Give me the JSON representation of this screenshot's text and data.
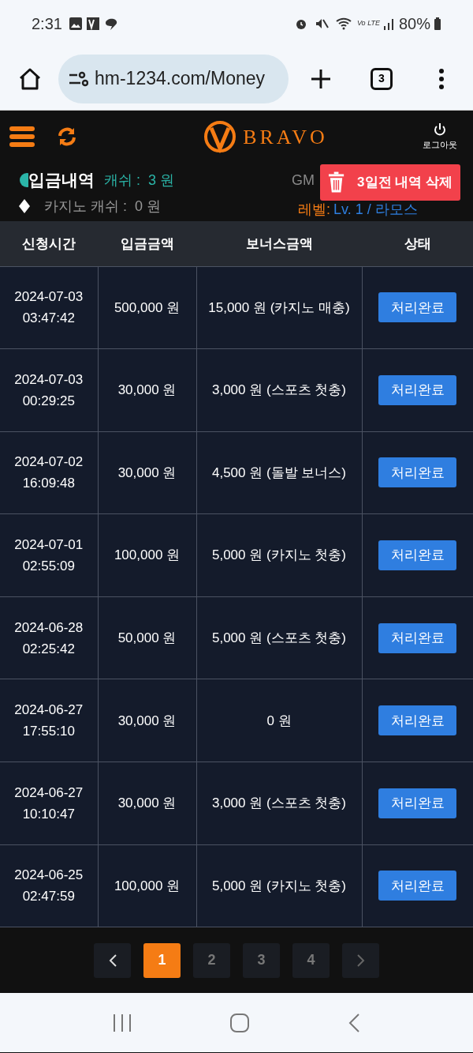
{
  "status_bar": {
    "time": "2:31",
    "battery": "80%",
    "network": "Vo LTE"
  },
  "browser": {
    "url": "hm-1234.com/Money",
    "tab_count": "3"
  },
  "header": {
    "logo": "BRAVO",
    "logout": "로그아웃"
  },
  "info": {
    "title": "입금내역",
    "sports_cash": "캐쉬 :  3 원",
    "casino_cash": "카지노 캐쉬 :  0 원",
    "gmt": "GM",
    "level_label": "레벨:",
    "level_value": "Lv. 1 / 라모스",
    "delete_button": "3일전 내역 삭제"
  },
  "table": {
    "columns": [
      "신청시간",
      "입금금액",
      "보너스금액",
      "상태"
    ],
    "rows": [
      {
        "date": "2024-07-03",
        "time": "03:47:42",
        "amount": "500,000 원",
        "bonus": "15,000 원 (카지노 매충)",
        "status": "처리완료"
      },
      {
        "date": "2024-07-03",
        "time": "00:29:25",
        "amount": "30,000 원",
        "bonus": "3,000 원 (스포츠 첫충)",
        "status": "처리완료"
      },
      {
        "date": "2024-07-02",
        "time": "16:09:48",
        "amount": "30,000 원",
        "bonus": "4,500 원 (돌발 보너스)",
        "status": "처리완료"
      },
      {
        "date": "2024-07-01",
        "time": "02:55:09",
        "amount": "100,000 원",
        "bonus": "5,000 원 (카지노 첫충)",
        "status": "처리완료"
      },
      {
        "date": "2024-06-28",
        "time": "02:25:42",
        "amount": "50,000 원",
        "bonus": "5,000 원 (스포츠 첫충)",
        "status": "처리완료"
      },
      {
        "date": "2024-06-27",
        "time": "17:55:10",
        "amount": "30,000 원",
        "bonus": "0 원",
        "status": "처리완료"
      },
      {
        "date": "2024-06-27",
        "time": "10:10:47",
        "amount": "30,000 원",
        "bonus": "3,000 원 (스포츠 첫충)",
        "status": "처리완료"
      },
      {
        "date": "2024-06-25",
        "time": "02:47:59",
        "amount": "100,000 원",
        "bonus": "5,000 원 (카지노 첫충)",
        "status": "처리완료"
      }
    ]
  },
  "pagination": {
    "pages": [
      {
        "label": "1",
        "selected": true
      },
      {
        "label": "2",
        "selected": false
      },
      {
        "label": "3",
        "selected": false
      },
      {
        "label": "4",
        "selected": false
      }
    ]
  }
}
